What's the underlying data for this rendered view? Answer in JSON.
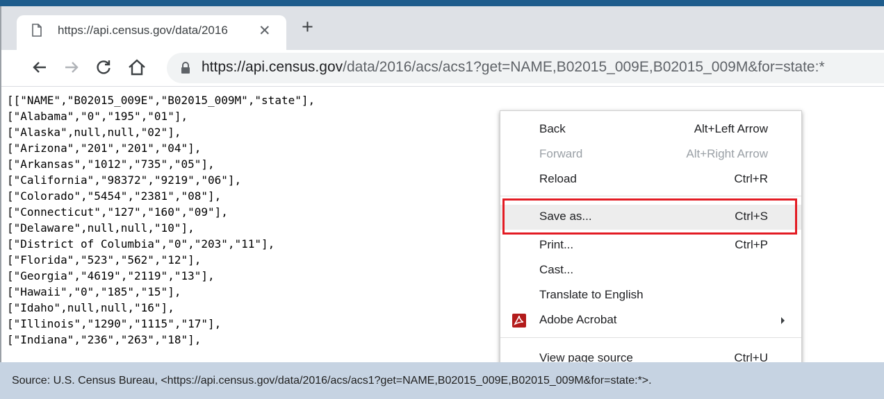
{
  "tab": {
    "title": "https://api.census.gov/data/2016",
    "close_icon": "close-icon",
    "page_icon": "page-icon"
  },
  "newtab": {
    "label": "+"
  },
  "toolbar": {
    "back_icon": "arrow-left-icon",
    "forward_icon": "arrow-right-icon",
    "reload_icon": "reload-icon",
    "home_icon": "home-icon"
  },
  "address_bar": {
    "url_host": "https://api.census.gov",
    "url_path": "/data/2016/acs/acs1?get=NAME,B02015_009E,B02015_009M&for=state:*"
  },
  "json_lines": [
    "[[\"NAME\",\"B02015_009E\",\"B02015_009M\",\"state\"],",
    "[\"Alabama\",\"0\",\"195\",\"01\"],",
    "[\"Alaska\",null,null,\"02\"],",
    "[\"Arizona\",\"201\",\"201\",\"04\"],",
    "[\"Arkansas\",\"1012\",\"735\",\"05\"],",
    "[\"California\",\"98372\",\"9219\",\"06\"],",
    "[\"Colorado\",\"5454\",\"2381\",\"08\"],",
    "[\"Connecticut\",\"127\",\"160\",\"09\"],",
    "[\"Delaware\",null,null,\"10\"],",
    "[\"District of Columbia\",\"0\",\"203\",\"11\"],",
    "[\"Florida\",\"523\",\"562\",\"12\"],",
    "[\"Georgia\",\"4619\",\"2119\",\"13\"],",
    "[\"Hawaii\",\"0\",\"185\",\"15\"],",
    "[\"Idaho\",null,null,\"16\"],",
    "[\"Illinois\",\"1290\",\"1115\",\"17\"],",
    "[\"Indiana\",\"236\",\"263\",\"18\"],"
  ],
  "context_menu": {
    "items": [
      {
        "label": "Back",
        "shortcut": "Alt+Left Arrow",
        "disabled": false
      },
      {
        "label": "Forward",
        "shortcut": "Alt+Right Arrow",
        "disabled": true
      },
      {
        "label": "Reload",
        "shortcut": "Ctrl+R",
        "disabled": false
      },
      {
        "label": "Save as...",
        "shortcut": "Ctrl+S",
        "disabled": false,
        "highlighted": true
      },
      {
        "label": "Print...",
        "shortcut": "Ctrl+P",
        "disabled": false
      },
      {
        "label": "Cast...",
        "shortcut": "",
        "disabled": false
      },
      {
        "label": "Translate to English",
        "shortcut": "",
        "disabled": false
      },
      {
        "label": "Adobe Acrobat",
        "shortcut": "",
        "disabled": false,
        "icon": "adobe-acrobat-icon",
        "submenu": true
      },
      {
        "label": "View page source",
        "shortcut": "Ctrl+U",
        "disabled": false
      }
    ],
    "highlight_color": "#e31b23"
  },
  "source_note": "Source: U.S. Census Bureau, <https://api.census.gov/data/2016/acs/acs1?get=NAME,B02015_009E,B02015_009M&for=state:*>.",
  "colors": {
    "top_accent": "#1e5c8c",
    "source_bar": "#c6d3e2",
    "highlight": "#e31b23"
  }
}
